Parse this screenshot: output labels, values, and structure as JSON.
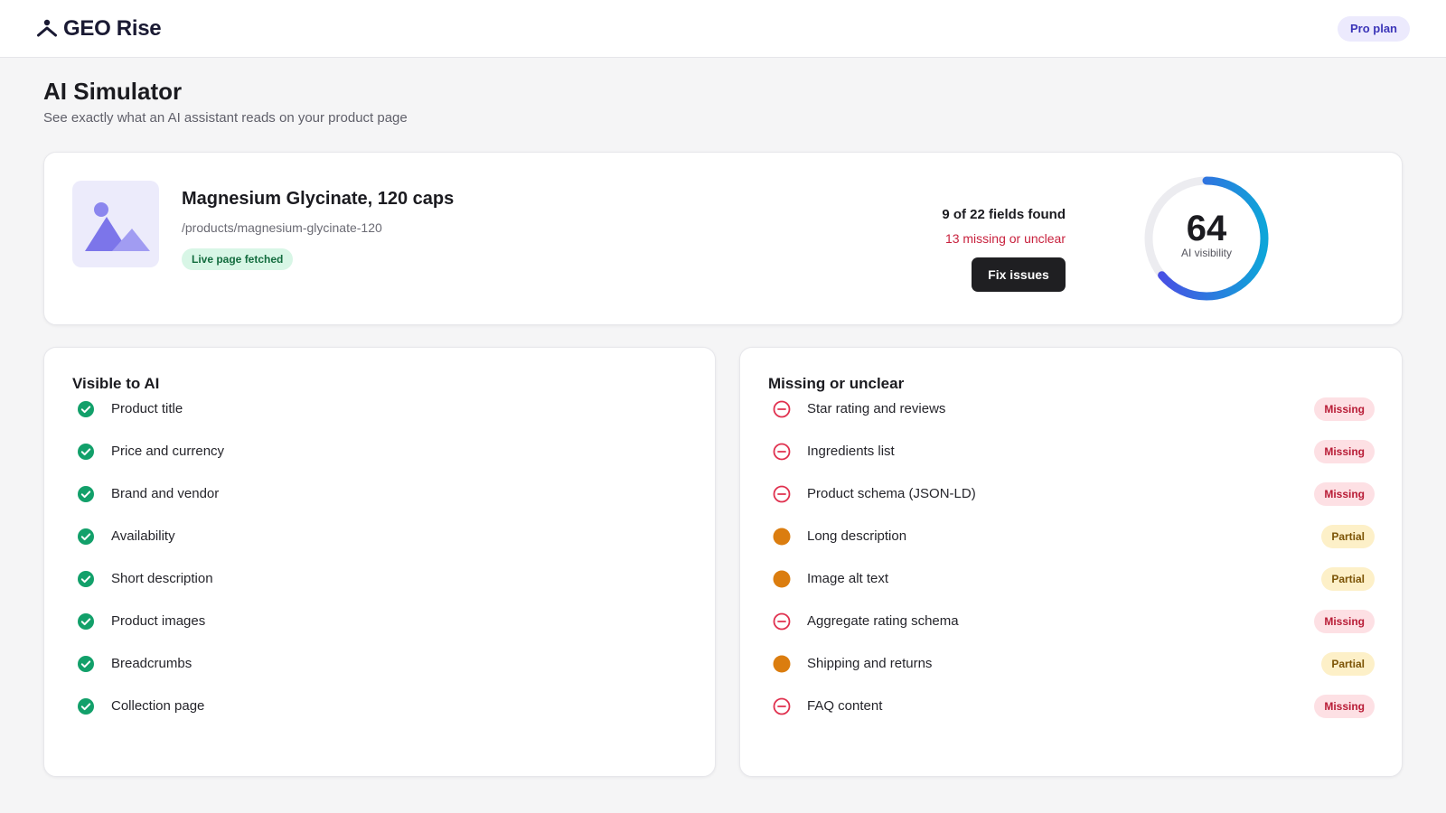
{
  "header": {
    "brand": "GEO Rise",
    "logo_icon": "person-up-icon",
    "plan_label": "Pro plan"
  },
  "page": {
    "title": "AI Simulator",
    "subtitle": "See exactly what an AI assistant reads on your product page"
  },
  "product": {
    "name": "Magnesium Glycinate, 120 caps",
    "url": "/products/magnesium-glycinate-120",
    "fetch_status": "Live page fetched",
    "thumbnail_icon": "image-placeholder-icon",
    "fields_found": "9 of 22 fields found",
    "missing_summary": "13 missing or unclear",
    "fix_button_label": "Fix issues",
    "score": "64",
    "score_value": 64,
    "score_label": "AI visibility"
  },
  "visible": {
    "title": "Visible to AI",
    "icon": "check-circle-icon",
    "items": [
      "Product title",
      "Price and currency",
      "Brand and vendor",
      "Availability",
      "Short description",
      "Product images",
      "Breadcrumbs",
      "Collection page"
    ]
  },
  "missing": {
    "title": "Missing or unclear",
    "items": [
      {
        "label": "Star rating and reviews",
        "status": "Missing",
        "kind": "missing"
      },
      {
        "label": "Ingredients list",
        "status": "Missing",
        "kind": "missing"
      },
      {
        "label": "Product schema (JSON-LD)",
        "status": "Missing",
        "kind": "missing"
      },
      {
        "label": "Long description",
        "status": "Partial",
        "kind": "partial"
      },
      {
        "label": "Image alt text",
        "status": "Partial",
        "kind": "partial"
      },
      {
        "label": "Aggregate rating schema",
        "status": "Missing",
        "kind": "missing"
      },
      {
        "label": "Shipping and returns",
        "status": "Partial",
        "kind": "partial"
      },
      {
        "label": "FAQ content",
        "status": "Missing",
        "kind": "missing"
      }
    ]
  },
  "colors": {
    "accent": "#3b35b8",
    "success": "#12a06a",
    "danger": "#e0304e",
    "warning": "#db7d0f",
    "gauge_start": "#4f46e5",
    "gauge_end": "#0ea5d9"
  }
}
